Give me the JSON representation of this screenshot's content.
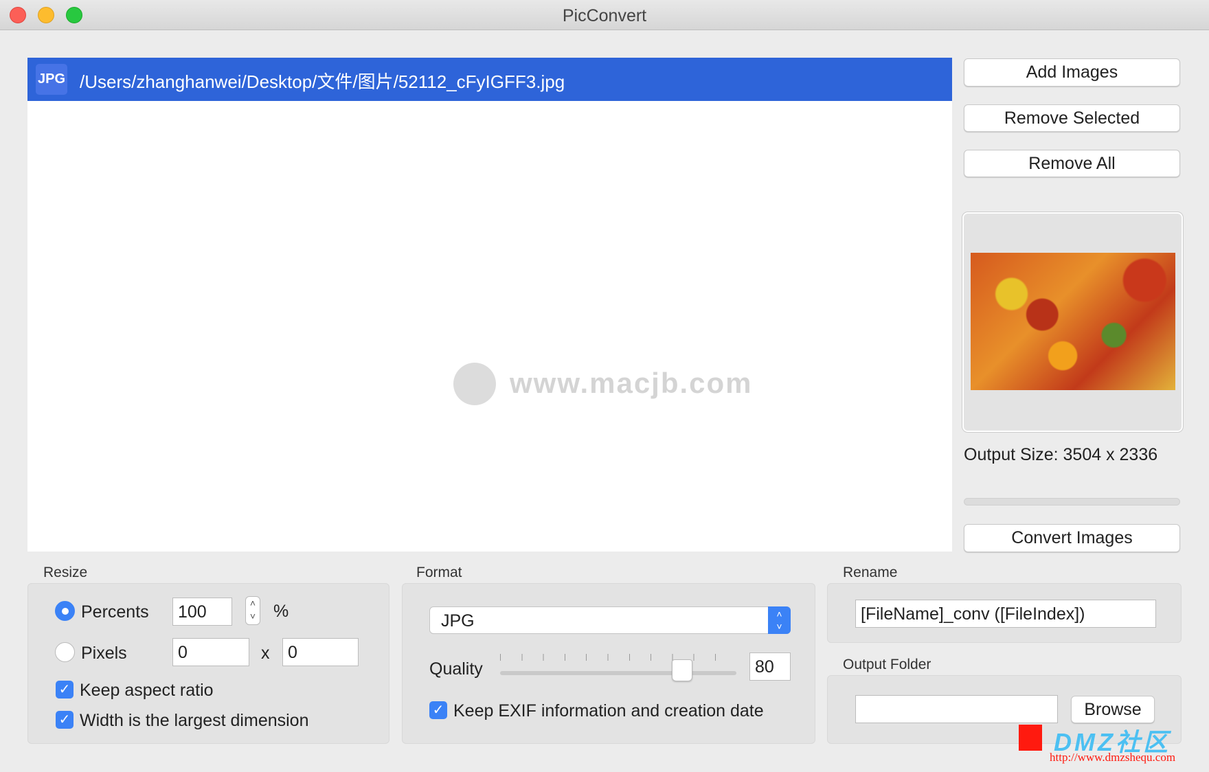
{
  "window": {
    "title": "PicConvert"
  },
  "file_list": {
    "items": [
      {
        "type_badge": "JPG",
        "path": "/Users/zhanghanwei/Desktop/文件/图片/52112_cFyIGFF3.jpg",
        "selected": true
      }
    ]
  },
  "watermark": {
    "text": "www.macjb.com"
  },
  "actions": {
    "add_images": "Add Images",
    "remove_selected": "Remove Selected",
    "remove_all": "Remove All",
    "convert_images": "Convert Images"
  },
  "preview": {
    "output_size": "Output Size: 3504 x 2336",
    "progress": 0
  },
  "resize": {
    "label": "Resize",
    "percents_label": "Percents",
    "percents_value": "100",
    "percent_sign": "%",
    "pixels_label": "Pixels",
    "width_value": "0",
    "x_sep": "x",
    "height_value": "0",
    "mode": "Percents",
    "keep_aspect_label": "Keep aspect ratio",
    "keep_aspect": true,
    "width_largest_label": "Width is the largest dimension",
    "width_largest": true
  },
  "format": {
    "label": "Format",
    "selected": "JPG",
    "quality_label": "Quality",
    "quality_value": "80",
    "keep_exif_label": "Keep EXIF information and creation date",
    "keep_exif": true
  },
  "rename": {
    "label": "Rename",
    "pattern": "[FileName]_conv ([FileIndex])"
  },
  "output": {
    "label": "Output Folder",
    "folder": "",
    "browse": "Browse"
  },
  "site_watermark": {
    "title": "DMZ社区",
    "url": "http://www.dmzshequ.com"
  },
  "colors": {
    "selection": "#2e64d9",
    "accent": "#3b82f6"
  }
}
